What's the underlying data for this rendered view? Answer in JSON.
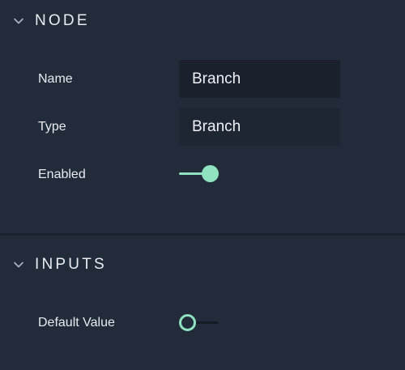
{
  "node_section": {
    "title": "NODE",
    "fields": {
      "name": {
        "label": "Name",
        "value": "Branch"
      },
      "type": {
        "label": "Type",
        "value": "Branch"
      },
      "enabled": {
        "label": "Enabled",
        "checked": true
      }
    }
  },
  "inputs_section": {
    "title": "INPUTS",
    "fields": {
      "default_value": {
        "label": "Default Value",
        "checked": false
      }
    }
  },
  "icons": {
    "collapse": "chevron-down-icon"
  },
  "colors": {
    "background": "#222b3a",
    "field_background": "#1a212c",
    "accent": "#8fe3c0",
    "text": "#e8ecf2"
  }
}
